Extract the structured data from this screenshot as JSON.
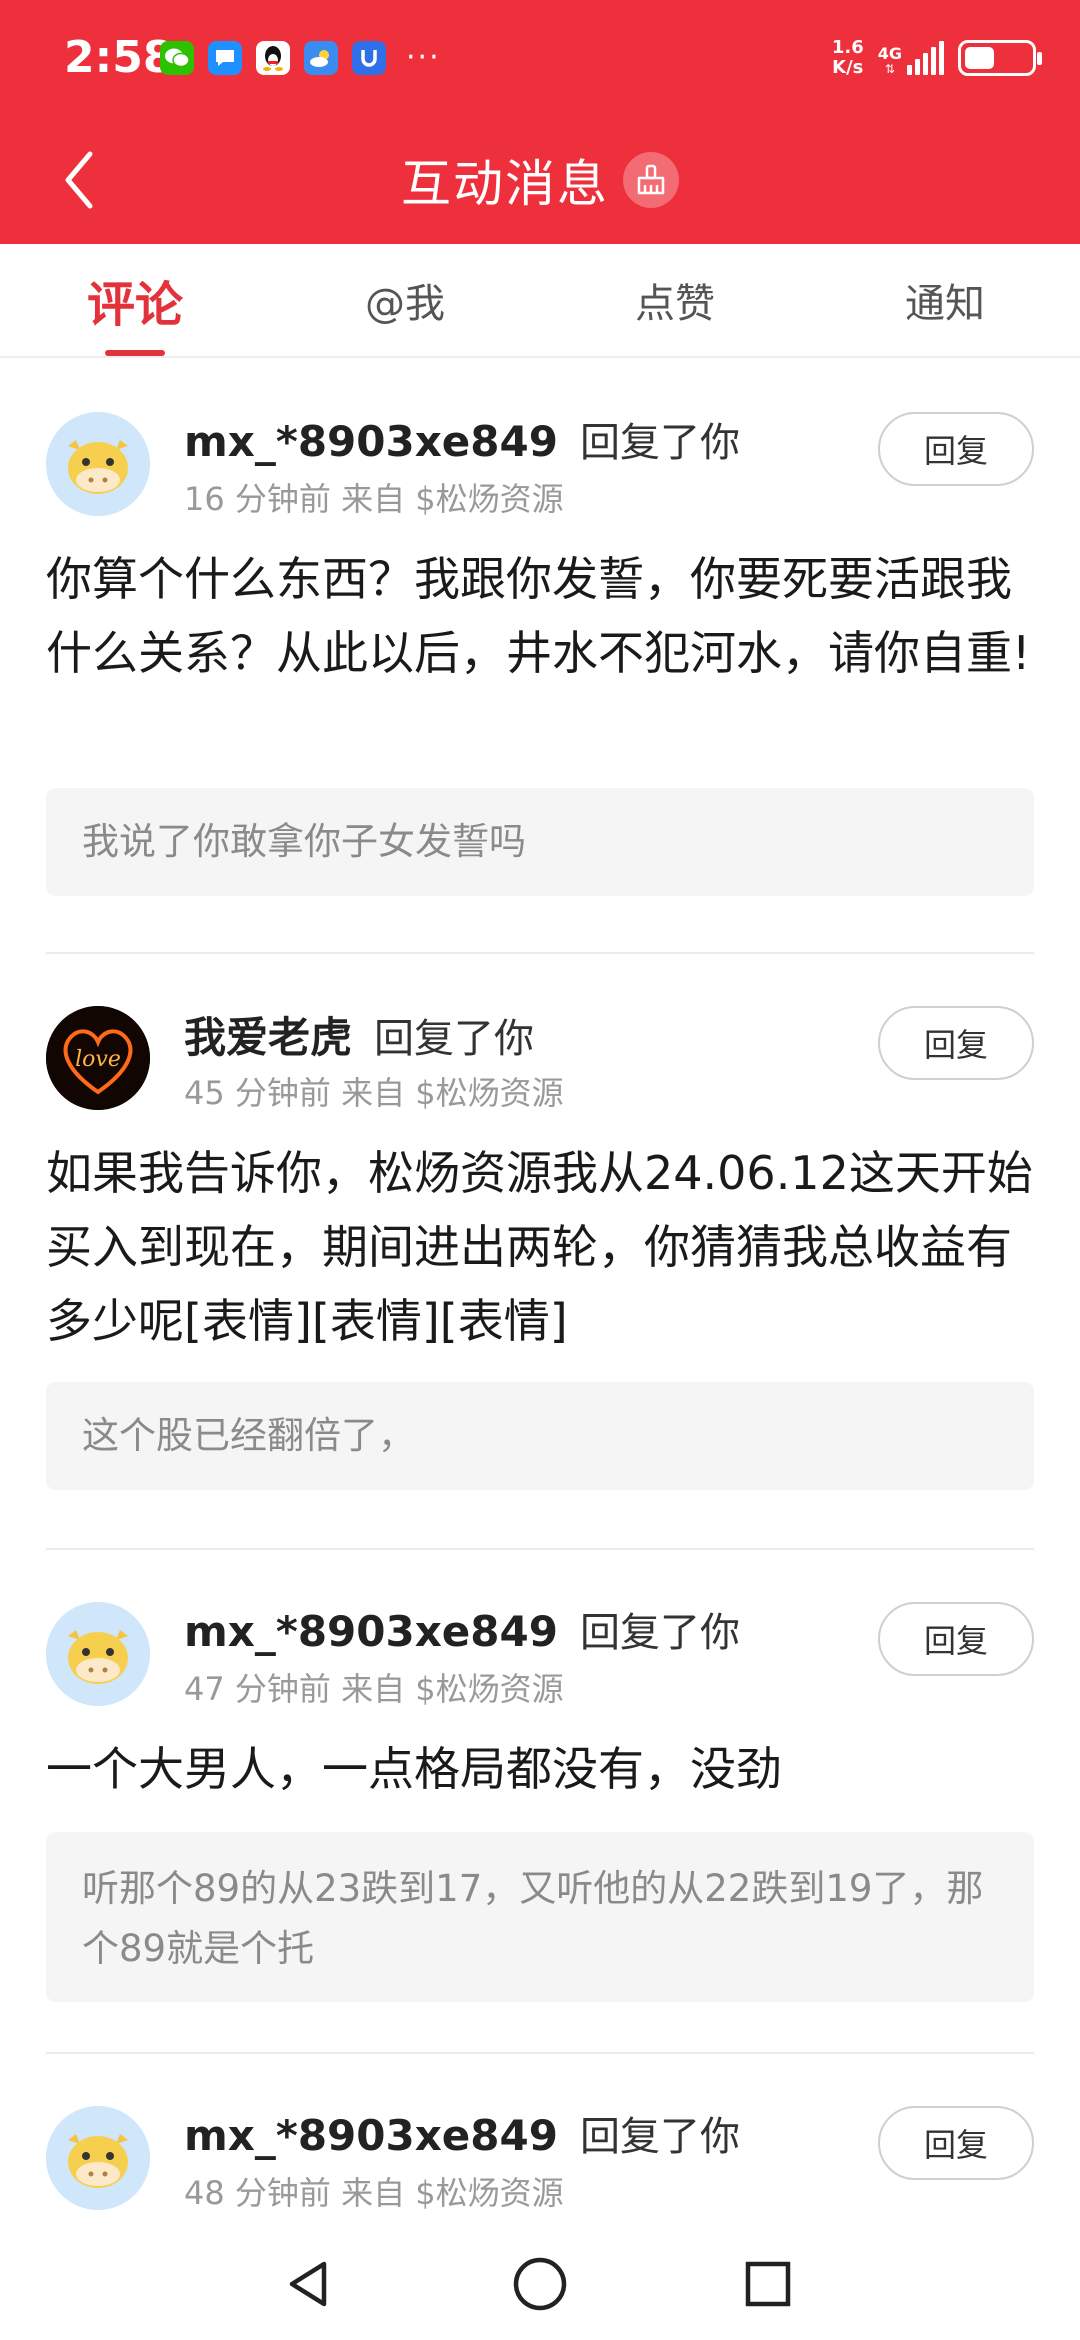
{
  "status_bar": {
    "time": "2:58",
    "net_speed": "1.6\nK/s",
    "net_speed_top": "1.6",
    "net_speed_bottom": "K/s",
    "network": "4G",
    "battery_level": 0.45,
    "notification_icons": [
      "wechat-icon",
      "message-icon",
      "qq-icon",
      "weather-icon",
      "app-u-icon"
    ],
    "more": "···"
  },
  "app_bar": {
    "title": "互动消息",
    "accent": "#ee2f3c"
  },
  "tabs": [
    {
      "label": "评论",
      "active": true
    },
    {
      "label": "@我",
      "active": false
    },
    {
      "label": "点赞",
      "active": false
    },
    {
      "label": "通知",
      "active": false
    }
  ],
  "messages": [
    {
      "username": "mx_*8903xe849",
      "action": "回复了你",
      "meta": "16 分钟前 来自 $松炀资源",
      "content": "你算个什么东西？我跟你发誓，你要死要活跟我什么关系？从此以后，井水不犯河水，请你自重!",
      "quote": "我说了你敢拿你子女发誓吗",
      "reply_label": "回复"
    },
    {
      "username": "我爱老虎",
      "action": "回复了你",
      "meta": "45 分钟前 来自 $松炀资源",
      "content": "如果我告诉你，松炀资源我从24.06.12这天开始买入到现在，期间进出两轮，你猜猜我总收益有多少呢[表情][表情][表情]",
      "quote": "这个股已经翻倍了，",
      "reply_label": "回复"
    },
    {
      "username": "mx_*8903xe849",
      "action": "回复了你",
      "meta": "47 分钟前 来自 $松炀资源",
      "content": "一个大男人，一点格局都没有，没劲",
      "quote": "听那个89的从23跌到17，又听他的从22跌到19了，那个89就是个托",
      "reply_label": "回复"
    },
    {
      "username": "mx_*8903xe849",
      "action": "回复了你",
      "meta": "48 分钟前 来自 $松炀资源",
      "reply_label": "回复"
    }
  ],
  "avatar_love_text": "love"
}
